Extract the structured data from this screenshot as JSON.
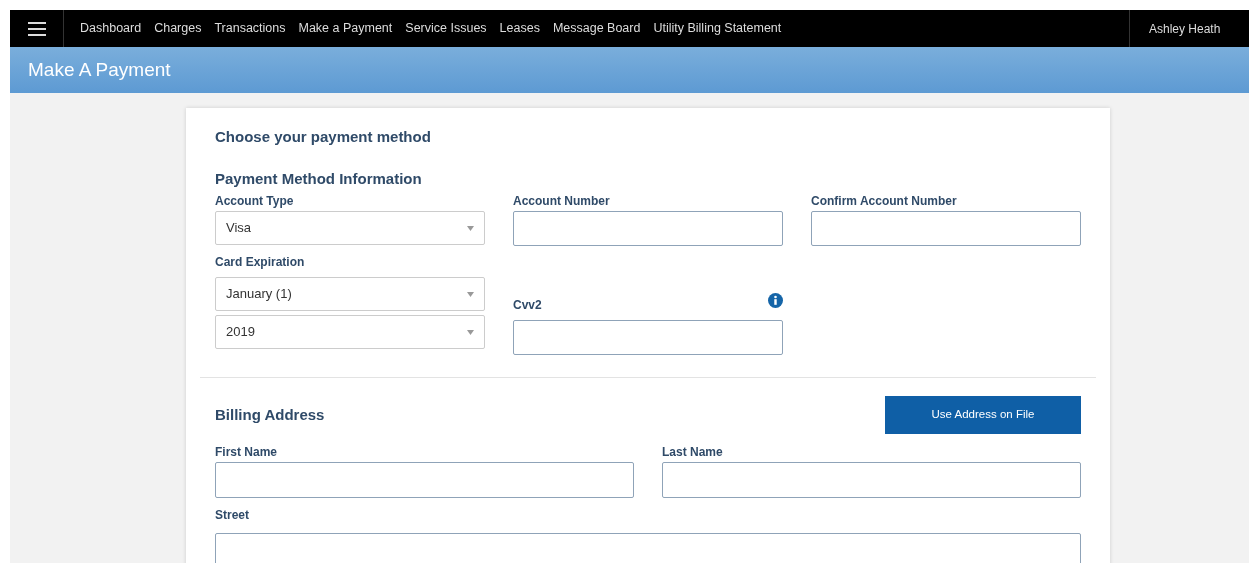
{
  "nav": {
    "items": [
      "Dashboard",
      "Charges",
      "Transactions",
      "Make a Payment",
      "Service Issues",
      "Leases",
      "Message Board",
      "Utility Billing Statement"
    ],
    "user": "Ashley Heath"
  },
  "page_title": "Make A Payment",
  "form": {
    "heading": "Choose your payment method",
    "section_1": "Payment Method Information",
    "account_type": {
      "label": "Account Type",
      "value": "Visa"
    },
    "account_number": {
      "label": "Account Number"
    },
    "confirm_account_number": {
      "label": "Confirm Account Number"
    },
    "card_expiration": {
      "label": "Card Expiration",
      "month": "January (1)",
      "year": "2019"
    },
    "cvv2": {
      "label": "Cvv2"
    },
    "section_2": "Billing Address",
    "use_address_button": "Use Address on File",
    "first_name": {
      "label": "First Name"
    },
    "last_name": {
      "label": "Last Name"
    },
    "street": {
      "label": "Street"
    }
  }
}
